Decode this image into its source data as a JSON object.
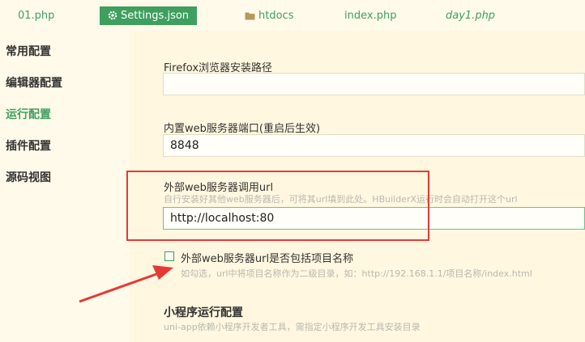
{
  "tabs": [
    {
      "label": "01.php",
      "icon": ""
    },
    {
      "label": "Settings.json",
      "icon": "gear-icon",
      "active": true
    },
    {
      "label": "htdocs",
      "icon": "folder-icon"
    },
    {
      "label": "index.php",
      "icon": ""
    },
    {
      "label": "day1.php",
      "icon": ""
    }
  ],
  "sidebar": {
    "items": [
      {
        "label": "常用配置"
      },
      {
        "label": "编辑器配置"
      },
      {
        "label": "运行配置",
        "active": true
      },
      {
        "label": "插件配置"
      },
      {
        "label": "源码视图"
      }
    ]
  },
  "settings": {
    "firefox_path": {
      "label": "Firefox浏览器安装路径",
      "value": ""
    },
    "builtin_port": {
      "label": "内置web服务器端口(重启后生效)",
      "value": "8848"
    },
    "external_url": {
      "label": "外部web服务器调用url",
      "hint": "自行安装好其他web服务器后，可将其url填到此处。HBuilderX运行时会自动打开这个url",
      "value": "http://localhost:80"
    },
    "include_project_name": {
      "label": "外部web服务器url是否包括项目名称",
      "hint": "如勾选，url中将项目名称作为二级目录，如：http://192.168.1.1/项目名称/index.html",
      "checked": false
    },
    "miniprogram": {
      "title": "小程序运行配置",
      "hint": "uni-app依赖小程序开发者工具，需指定小程序开发工具安装目录"
    }
  },
  "colors": {
    "accent": "#3e9f5e",
    "annotation": "#e53935",
    "background": "#fffae9"
  }
}
